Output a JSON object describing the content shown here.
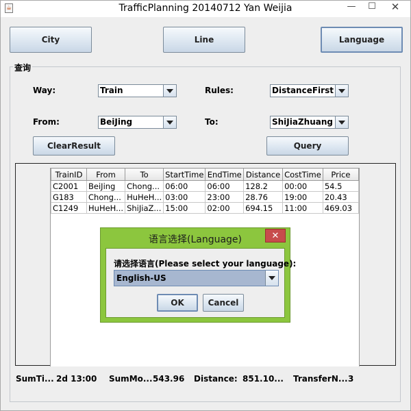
{
  "window": {
    "title": "TrafficPlanning 20140712 Yan Weijia",
    "icon": "java-cup-icon",
    "controls": {
      "minimize": "—",
      "maximize": "☐",
      "close": "✕"
    }
  },
  "nav_buttons": {
    "city": "City",
    "line": "Line",
    "language": "Language"
  },
  "query_group": {
    "legend": "查询",
    "way_label": "Way:",
    "way_value": "Train",
    "rules_label": "Rules:",
    "rules_value": "DistanceFirst",
    "from_label": "From:",
    "from_value": "BeiJing",
    "to_label": "To:",
    "to_value": "ShiJiaZhuang",
    "clear_button": "ClearResult",
    "query_button": "Query"
  },
  "table": {
    "columns": [
      "TrainID",
      "From",
      "To",
      "StartTime",
      "EndTime",
      "Distance",
      "CostTime",
      "Price"
    ],
    "rows": [
      [
        "C2001",
        "BeiJing",
        "Chong...",
        "06:00",
        "06:00",
        "128.2",
        "00:00",
        "54.5"
      ],
      [
        "G183",
        "Chong...",
        "HuHeH...",
        "03:00",
        "23:00",
        "28.76",
        "19:00",
        "20.43"
      ],
      [
        "C1249",
        "HuHeH...",
        "ShiJiaZ...",
        "15:00",
        "02:00",
        "694.15",
        "11:00",
        "469.03"
      ]
    ]
  },
  "summary": {
    "sum_time_label": "SumTi...",
    "sum_time_value": "2d 13:00",
    "sum_money_label": "SumMo...",
    "sum_money_value": "543.96",
    "distance_label": "Distance:",
    "distance_value": "851.10...",
    "transfer_label": "TransferN...",
    "transfer_value": "3"
  },
  "dialog": {
    "title": "语言选择(Language)",
    "close": "✕",
    "prompt": "请选择语言(Please select your language):",
    "selected_language": "English-US",
    "ok_label": "OK",
    "cancel_label": "Cancel"
  },
  "colors": {
    "dialog_frame": "#8cc63e",
    "dialog_close": "#c74c4c",
    "window_bg": "#eeeeee",
    "selection": "#a7b7d0"
  }
}
